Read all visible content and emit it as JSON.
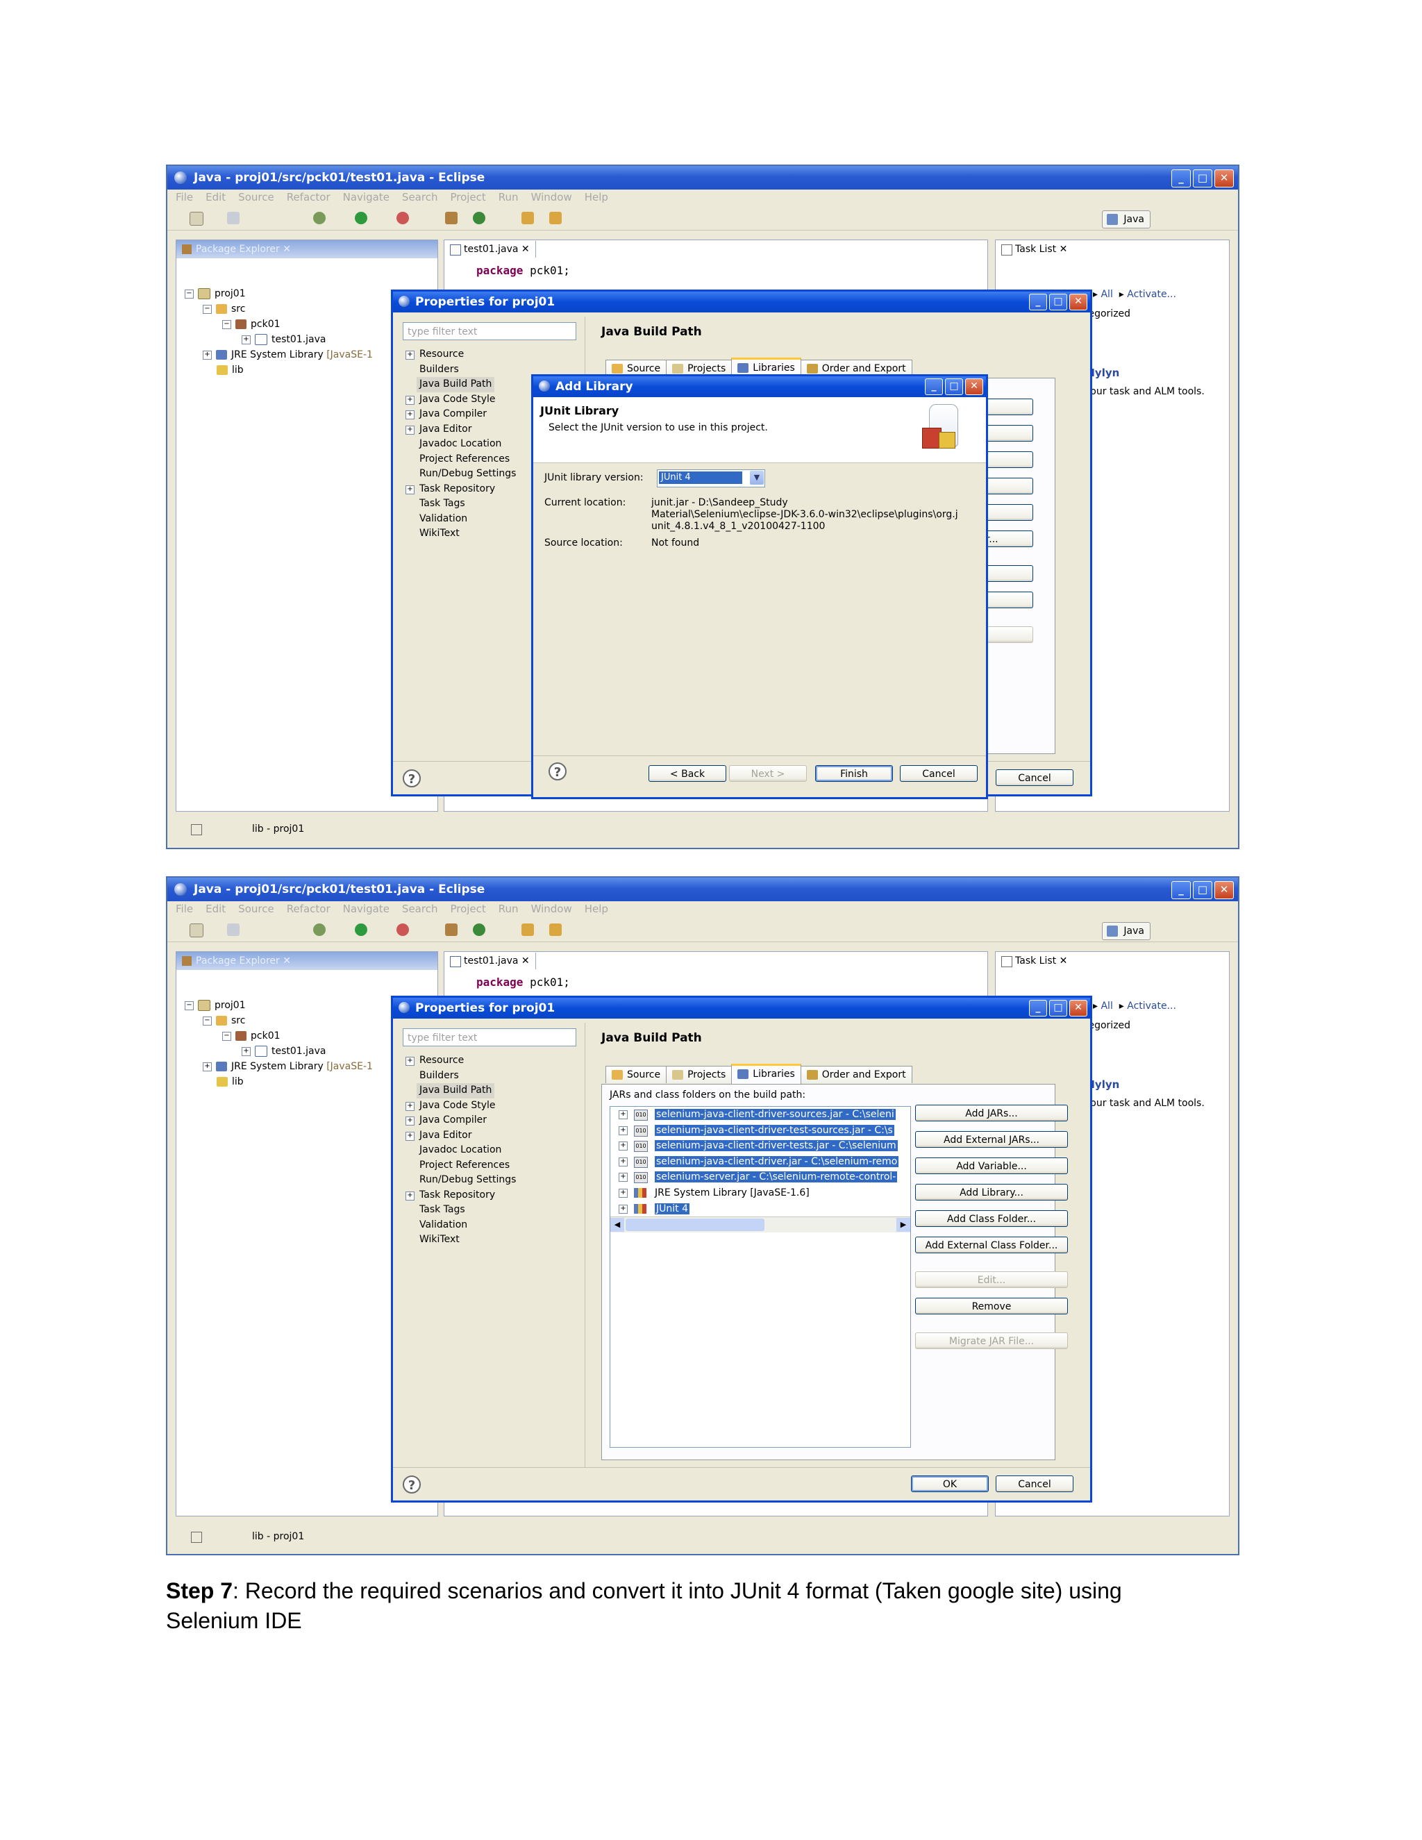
{
  "window": {
    "title": "Java - proj01/src/pck01/test01.java - Eclipse",
    "menu": [
      "File",
      "Edit",
      "Source",
      "Refactor",
      "Navigate",
      "Search",
      "Project",
      "Run",
      "Window",
      "Help"
    ],
    "perspective": "Java",
    "status_text": "lib - proj01"
  },
  "package_explorer": {
    "tab_label": "Package Explorer",
    "tree": [
      "proj01",
      "src",
      "pck01",
      "test01.java",
      "JRE System Library",
      "[JavaSE-1",
      "lib"
    ]
  },
  "editor": {
    "tab_label": "test01.java",
    "code_keyword": "package",
    "code_rest": "pck01;"
  },
  "task_list": {
    "tab_label": "Task List",
    "filter_all": "All",
    "activate": "Activate...",
    "categorized_fragment": "tegorized",
    "mylyn_title": "Mylyn",
    "mylyn_text": "your task and ALM tools."
  },
  "properties": {
    "title": "Properties for proj01",
    "filter_placeholder": "type filter text",
    "nav_items": [
      "Resource",
      "Builders",
      "Java Build Path",
      "Java Code Style",
      "Java Compiler",
      "Java Editor",
      "Javadoc Location",
      "Project References",
      "Run/Debug Settings",
      "Task Repository",
      "Task Tags",
      "Validation",
      "WikiText"
    ],
    "page_title": "Java Build Path",
    "tabs": [
      "Source",
      "Projects",
      "Libraries",
      "Order and Export"
    ],
    "list_heading": "JARs and class folders on the build path:",
    "buttons": [
      "Add JARs...",
      "Add External JARs...",
      "Add Variable...",
      "Add Library...",
      "Add Class Folder...",
      "Add External Class Folder...",
      "Edit...",
      "Remove",
      "Migrate JAR File..."
    ],
    "partial_buttons": [
      "ARs...",
      "nal JARs...",
      "riable...",
      "brary...",
      "s Folder...",
      "Class Folder...",
      "t...",
      "nove",
      "AR File..."
    ],
    "ok": "OK",
    "cancel": "Cancel",
    "libraries": [
      "selenium-java-client-driver-sources.jar - C:\\seleni",
      "selenium-java-client-driver-test-sources.jar - C:\\s",
      "selenium-java-client-driver-tests.jar - C:\\selenium",
      "selenium-java-client-driver.jar - C:\\selenium-remo",
      "selenium-server.jar - C:\\selenium-remote-control-",
      "JRE System Library [JavaSE-1.6]",
      "JUnit 4"
    ]
  },
  "add_library": {
    "title": "Add Library",
    "heading": "JUnit Library",
    "description": "Select the JUnit version to use in this project.",
    "version_label": "JUnit library version:",
    "version_value": "JUnit 4",
    "current_label": "Current location:",
    "current_value_1": "junit.jar - D:\\Sandeep_Study",
    "current_value_2": "Material\\Selenium\\eclipse-JDK-3.6.0-win32\\eclipse\\plugins\\org.j",
    "current_value_3": "unit_4.8.1.v4_8_1_v20100427-1100",
    "source_label": "Source location:",
    "source_value": "Not found",
    "back": "< Back",
    "next": "Next >",
    "finish": "Finish",
    "cancel": "Cancel"
  },
  "step": {
    "label": "Step 7",
    "text_1": ": Record the required scenarios and convert it into JUnit 4 format (Taken google site) using",
    "text_2": "Selenium IDE"
  },
  "colors": {
    "xp_title": "#0a46d8",
    "selection": "#316ac5",
    "dialog_bg": "#ece9d8"
  }
}
